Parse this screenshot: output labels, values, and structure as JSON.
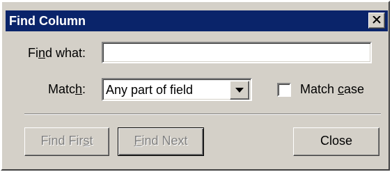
{
  "dialog": {
    "title": "Find Column",
    "title_bar_color": "#0a246a",
    "close_icon": "close-icon"
  },
  "find_what": {
    "label_pre": "Fi",
    "label_accel": "n",
    "label_post": "d what:",
    "value": ""
  },
  "match": {
    "label_pre": "Matc",
    "label_accel": "h",
    "label_post": ":",
    "selected": "Any part of field",
    "dropdown_icon": "chevron-down-icon"
  },
  "match_case": {
    "label_pre": "Match ",
    "label_accel": "c",
    "label_post": "ase",
    "checked": false
  },
  "buttons": {
    "find_first_pre": "Find Fir",
    "find_first_accel": "s",
    "find_first_post": "t",
    "find_next_accel": "F",
    "find_next_post": "ind Next",
    "close": "Close"
  }
}
